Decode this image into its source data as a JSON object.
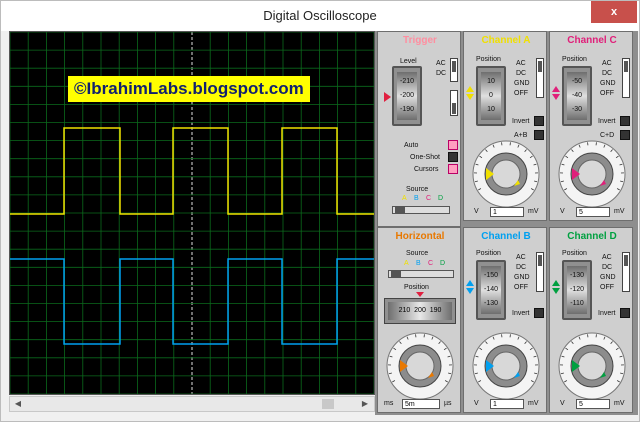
{
  "window": {
    "title": "Digital Oscilloscope",
    "close_label": "x"
  },
  "screen": {
    "banner": "©IbrahimLabs.blogspot.com"
  },
  "scrollbar": {
    "left": "◀",
    "right": "▶"
  },
  "colors": {
    "chA": "#f0e000",
    "chB": "#00a0f0",
    "chC": "#e0207a",
    "chD": "#00a040",
    "trigger": "#ff8ea0",
    "horizontal": "#e87800"
  },
  "trigger": {
    "title": "Trigger",
    "level_label": "Level",
    "ac": "AC",
    "dc": "DC",
    "dial": [
      "-210",
      "-200",
      "-190"
    ],
    "auto": "Auto",
    "oneshot": "One-Shot",
    "cursors": "Cursors",
    "source_label": "Source",
    "source_letters": [
      "A",
      "B",
      "C",
      "D"
    ]
  },
  "horizontal": {
    "title": "Horizontal",
    "source_label": "Source",
    "source_letters": [
      "A",
      "B",
      "C",
      "D"
    ],
    "position_label": "Position",
    "dial": [
      "210",
      "200",
      "190"
    ],
    "knob_scale": [
      "0.5",
      "0.2",
      "0.1",
      "50",
      "20",
      "10",
      "5",
      "2",
      "1",
      "0.5",
      "0.2",
      "0.1",
      "200",
      "100",
      "50",
      "20",
      "10",
      "5",
      "2",
      "1"
    ],
    "unit_left": "ms",
    "value": "5m",
    "unit_right": "µs"
  },
  "channels": {
    "a": {
      "title": "Channel A",
      "position_label": "Position",
      "dial": [
        "10",
        "0",
        "10"
      ],
      "ac": "AC",
      "dc": "DC",
      "gnd": "GND",
      "off": "OFF",
      "invert": "Invert",
      "combo": "A+B",
      "unit_left": "V",
      "value": "1",
      "unit_right": "mV",
      "knob_scale": [
        "0.5",
        "0.2",
        "0.1",
        "50",
        "20",
        "10",
        "5",
        "2",
        "1",
        "0.5",
        "0.2",
        "0.1",
        "20",
        "10",
        "5",
        "2",
        "1"
      ]
    },
    "b": {
      "title": "Channel B",
      "position_label": "Position",
      "dial": [
        "-150",
        "-140",
        "-130"
      ],
      "ac": "AC",
      "dc": "DC",
      "gnd": "GND",
      "off": "OFF",
      "invert": "Invert",
      "unit_left": "V",
      "value": "1",
      "unit_right": "mV",
      "knob_scale": [
        "0.5",
        "0.2",
        "0.1",
        "50",
        "20",
        "10",
        "5",
        "2",
        "1",
        "0.5",
        "0.2",
        "0.1",
        "20",
        "10",
        "5",
        "2",
        "1"
      ]
    },
    "c": {
      "title": "Channel C",
      "position_label": "Position",
      "dial": [
        "-50",
        "-40",
        "-30"
      ],
      "ac": "AC",
      "dc": "DC",
      "gnd": "GND",
      "off": "OFF",
      "invert": "Invert",
      "combo": "C+D",
      "unit_left": "V",
      "value": "5",
      "unit_right": "mV",
      "knob_scale": [
        "0.5",
        "0.2",
        "0.1",
        "50",
        "20",
        "10",
        "5",
        "2",
        "1",
        "0.5",
        "0.2",
        "0.1",
        "20",
        "10",
        "5",
        "2",
        "1"
      ]
    },
    "d": {
      "title": "Channel D",
      "position_label": "Position",
      "dial": [
        "-130",
        "-120",
        "-110"
      ],
      "ac": "AC",
      "dc": "DC",
      "gnd": "GND",
      "off": "OFF",
      "invert": "Invert",
      "unit_left": "V",
      "value": "5",
      "unit_right": "mV",
      "knob_scale": [
        "0.5",
        "0.2",
        "0.1",
        "50",
        "20",
        "10",
        "5",
        "2",
        "1",
        "0.5",
        "0.2",
        "0.1",
        "20",
        "10",
        "5",
        "2",
        "1"
      ]
    }
  }
}
